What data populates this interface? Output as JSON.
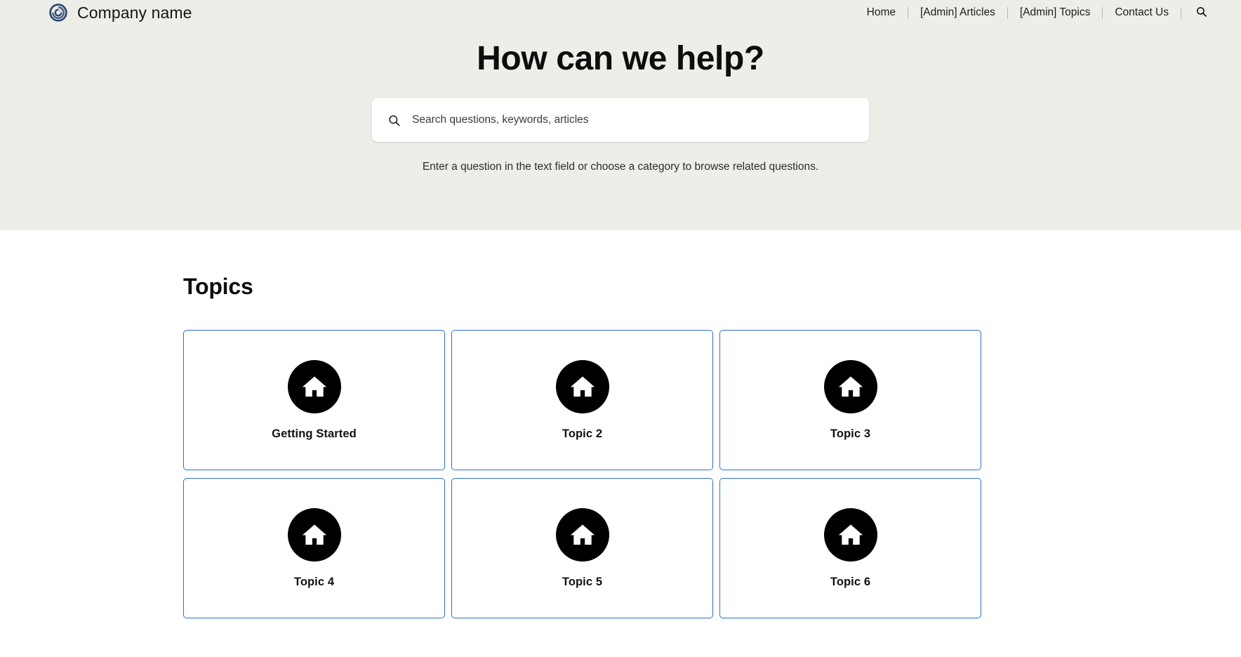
{
  "header": {
    "brand_name": "Company name",
    "logo_icon": "swirl-circle-logo",
    "nav_items": [
      {
        "label": "Home"
      },
      {
        "label": "[Admin] Articles"
      },
      {
        "label": "[Admin] Topics"
      },
      {
        "label": "Contact Us"
      }
    ],
    "search_icon": "search-icon"
  },
  "hero": {
    "title": "How can we help?",
    "search_placeholder": "Search questions, keywords, articles",
    "search_value": "",
    "search_icon": "search-icon",
    "subtext": "Enter a question in the text field or choose a category to browse related questions."
  },
  "topics": {
    "heading": "Topics",
    "cards": [
      {
        "label": "Getting Started",
        "icon": "home-icon"
      },
      {
        "label": "Topic 2",
        "icon": "home-icon"
      },
      {
        "label": "Topic 3",
        "icon": "home-icon"
      },
      {
        "label": "Topic 4",
        "icon": "home-icon"
      },
      {
        "label": "Topic 5",
        "icon": "home-icon"
      },
      {
        "label": "Topic 6",
        "icon": "home-icon"
      }
    ]
  },
  "colors": {
    "hero_background": "#eeeee8",
    "page_background": "#ffffff",
    "card_border": "#2f6fc4",
    "icon_circle": "#000000",
    "logo": "#2e4a73",
    "text": "#111111"
  }
}
